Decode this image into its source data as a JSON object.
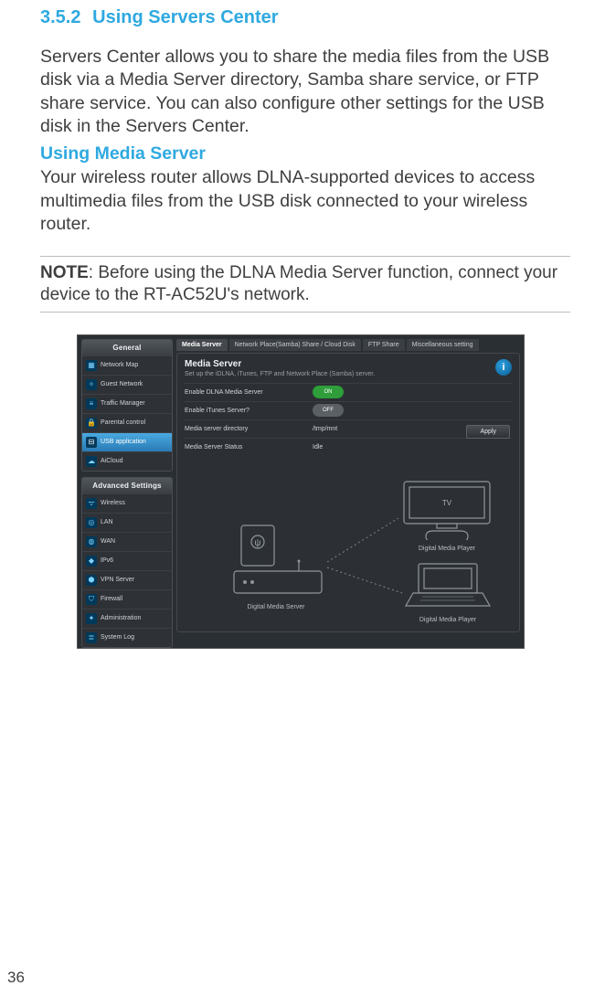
{
  "section": {
    "number": "3.5.2",
    "title": "Using Servers Center"
  },
  "para1": "Servers Center allows you to share the media files from the USB disk via a Media Server directory, Samba share service, or FTP share service. You can also configure other settings for the USB disk in the Servers Center.",
  "sub1": "Using Media Server",
  "para2": "Your wireless router allows DLNA-supported devices to access multimedia files from the USB disk connected to your wireless router.",
  "note": {
    "label": "NOTE",
    "text": ":  Before using the DLNA Media Server function, connect your device to the RT-AC52U's network."
  },
  "page_number": "36",
  "screenshot": {
    "sidebar": {
      "general_header": "General",
      "general_items": [
        {
          "label": "Network Map"
        },
        {
          "label": "Guest Network"
        },
        {
          "label": "Traffic Manager"
        },
        {
          "label": "Parental control"
        },
        {
          "label": "USB application",
          "active": true
        },
        {
          "label": "AiCloud"
        }
      ],
      "advanced_header": "Advanced Settings",
      "advanced_items": [
        {
          "label": "Wireless"
        },
        {
          "label": "LAN"
        },
        {
          "label": "WAN"
        },
        {
          "label": "IPv6"
        },
        {
          "label": "VPN Server"
        },
        {
          "label": "Firewall"
        },
        {
          "label": "Administration"
        },
        {
          "label": "System Log"
        }
      ]
    },
    "tabs": [
      {
        "label": "Media Server",
        "active": true
      },
      {
        "label": "Network Place(Samba) Share / Cloud Disk"
      },
      {
        "label": "FTP Share"
      },
      {
        "label": "Miscellaneous setting"
      }
    ],
    "panel": {
      "title": "Media Server",
      "subtitle": "Set up the iDLNA, iTunes, FTP and Network Place (Samba) server.",
      "rows": {
        "r1_label": "Enable DLNA Media Server",
        "r1_value": "ON",
        "r2_label": "Enable iTunes Server?",
        "r2_value": "OFF",
        "r3_label": "Media server directory",
        "r3_value": "/tmp/mnt",
        "r4_label": "Media Server Status",
        "r4_value": "Idle"
      },
      "apply": "Apply"
    },
    "diagram": {
      "server_caption": "Digital Media Server",
      "tv_label": "TV",
      "player1_caption": "Digital Media Player",
      "player2_caption": "Digital Media Player"
    }
  }
}
